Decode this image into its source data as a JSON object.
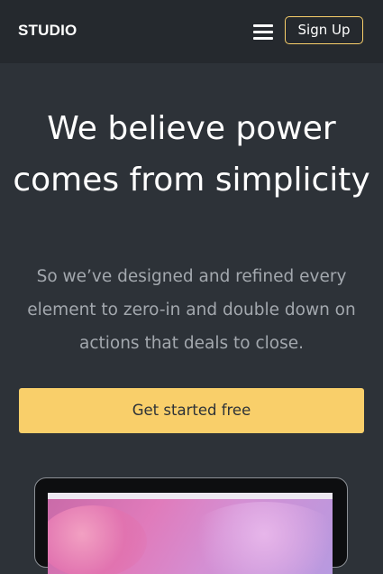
{
  "nav": {
    "brand": "STUDIO",
    "menu_icon": "hamburger-menu-icon",
    "signup_label": "Sign Up"
  },
  "hero": {
    "title": "We believe power comes from simplicity",
    "subtitle": "So we’ve designed and refined every element to zero-in and double down on actions that deals to close.",
    "cta_label": "Get started free"
  },
  "colors": {
    "background": "#2d3238",
    "navbar": "#25292e",
    "accent": "#f9cf6a",
    "subtitle_text": "#a3a8ae"
  }
}
